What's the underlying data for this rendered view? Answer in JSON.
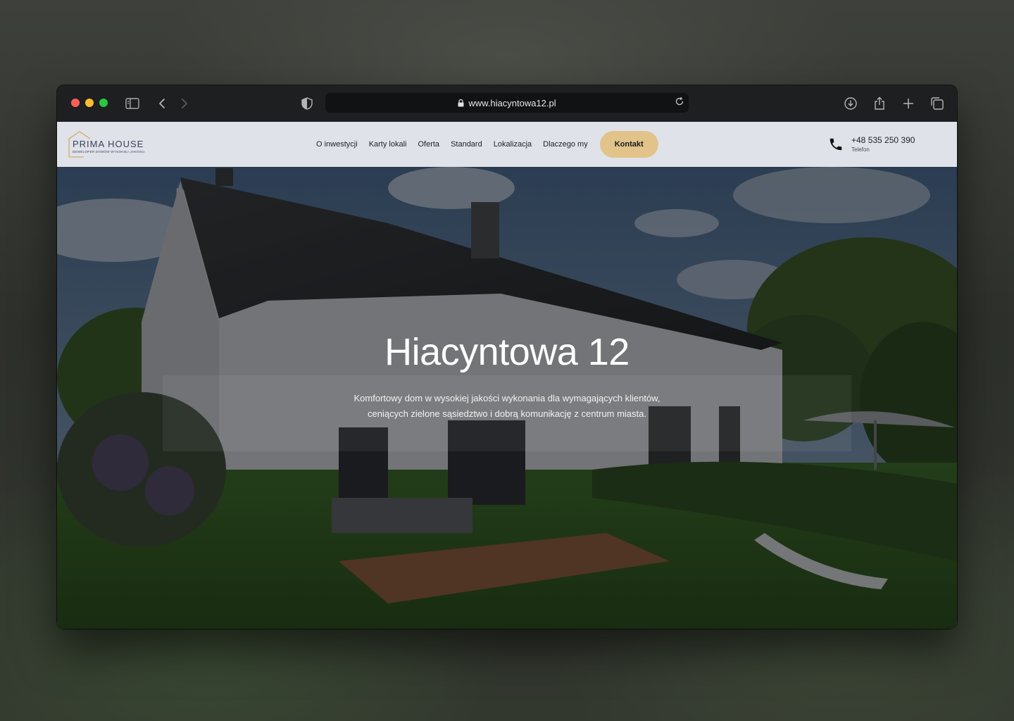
{
  "browser": {
    "url": "www.hiacyntowa12.pl"
  },
  "site": {
    "logo": {
      "name": "PRIMA HOUSE",
      "tagline": "DEWELOPER DOMÓW WYSOKIEJ JAKOŚCI"
    },
    "nav": [
      {
        "label": "O inwestycji"
      },
      {
        "label": "Karty lokali"
      },
      {
        "label": "Oferta"
      },
      {
        "label": "Standard"
      },
      {
        "label": "Lokalizacja"
      },
      {
        "label": "Dlaczego my"
      }
    ],
    "cta_label": "Kontakt",
    "phone": {
      "number": "+48 535 250 390",
      "label": "Telefon"
    }
  },
  "hero": {
    "title": "Hiacyntowa 12",
    "subtitle_line1": "Komfortowy dom w wysokiej jakości wykonania dla wymagających klientów,",
    "subtitle_line2": "ceniących zielone sąsiedztwo i dobrą komunikację z centrum miasta."
  },
  "colors": {
    "accent": "#e2c38a",
    "header_bg": "#dfe3e9",
    "browser_chrome": "#1d1f21"
  }
}
